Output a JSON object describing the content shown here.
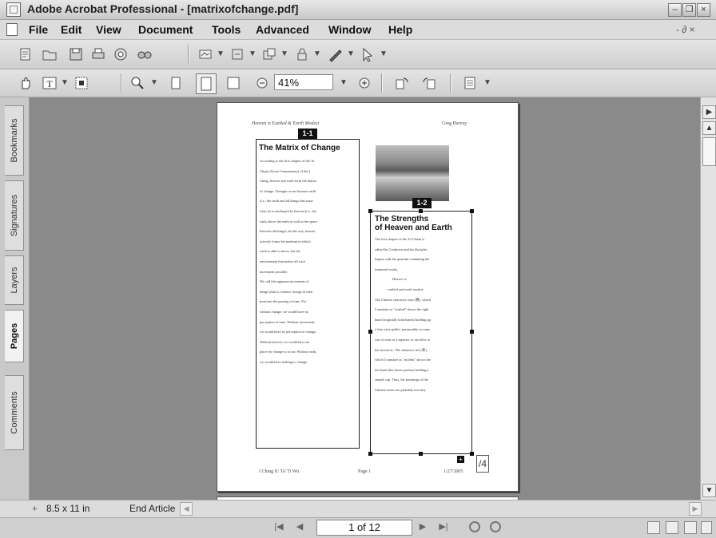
{
  "window": {
    "title": "Adobe Acrobat Professional - [matrixofchange.pdf]",
    "minimize": "–",
    "restore": "❐",
    "close": "×",
    "doc_restore": "- ∂ ×"
  },
  "menu": [
    "File",
    "Edit",
    "View",
    "Document",
    "Tools",
    "Advanced",
    "Window",
    "Help"
  ],
  "toolbar": {
    "zoom_value": "41%"
  },
  "nav_tabs": [
    "Bookmarks",
    "Signatures",
    "Layers",
    "Pages",
    "Comments"
  ],
  "document": {
    "header_left": "Heaven is Exalted & Earth Modest",
    "header_right": "Greg Harvey",
    "article1": {
      "badge": "1-1",
      "heading": "The Matrix of Change",
      "lines": [
        "According to the first chapter of the Ta",
        "Chuan (Great Commentary) of the I",
        "Ching, heaven and earth form the matrix",
        "of change. Changes occur because earth",
        "(i.e., the earth and all things that issue",
        "from it) is enveloped by heaven (i.e., the",
        "vault above the earth as well as the space",
        "between all things). In this way, heaven",
        "actively forms the medium in which",
        "earth is able to move, but the",
        "environment that makes all such",
        "movement possible.",
        "We call this apparent movement of",
        "things (that is, relative change in their",
        "position) the passing of time. For",
        "without change, we would have no",
        "perception of time. Without movement,",
        "we would have no perception of change.",
        "Without heaven, we would have no",
        "place for change to occur. Without earth,",
        "we would have nothing to change."
      ]
    },
    "article2": {
      "badge": "1-2",
      "heading_line1": "The Strengths",
      "heading_line2": "of Heaven and Earth",
      "lines": [
        "The first chapter of the Ta Chuan is",
        "edited by Confucius and his disciples",
        "begins with the quatrain containing the",
        "immortal words,",
        "Heaven is",
        "exalted and earth modest.",
        "The Chinese character, tsun (尊), which",
        "I translate as \"exalted\" shows the right",
        "hand (originally both hands) holding up",
        "a fine wine goblet, presumably in some",
        "sort of toast to a superior or sacrifice to",
        "the ancestors. The character, bei (卑),",
        "which I translate as \"modest\" shows the",
        "left hand (the lesser portion) holding a",
        "simple cup. Thus, the meanings of the",
        "Chinese terms are probably not only"
      ],
      "continue_label": "/4"
    },
    "footer_left": "I Ching II: Ta' Ti Wu",
    "footer_center": "Page 1",
    "footer_right": "1/27/2005"
  },
  "hbar": {
    "page_size": "8.5 x 11 in",
    "end_article": "End Article"
  },
  "status": {
    "page_indicator": "1 of 12"
  }
}
